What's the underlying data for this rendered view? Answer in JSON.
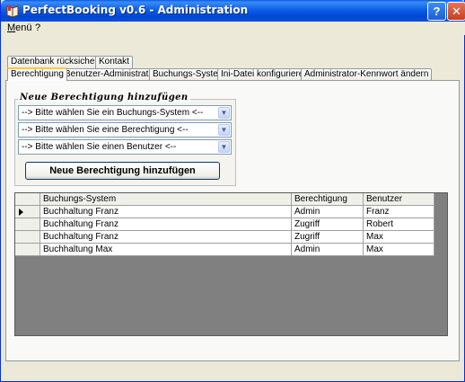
{
  "window": {
    "title": "PerfectBooking v0.6 - Administration",
    "help_label": "?",
    "close_label": "✕"
  },
  "menubar": {
    "items": [
      {
        "label": "Menü",
        "underline": "M"
      },
      {
        "label": "?"
      }
    ]
  },
  "tabs_row1": [
    "Datenbank rücksichern",
    "Kontakt"
  ],
  "tabs_row2": [
    "Berechtigung",
    "Benutzer-Administration",
    "Buchungs-System",
    "Ini-Datei konfigurieren",
    "Administrator-Kennwort ändern"
  ],
  "active_tab": "Berechtigung",
  "group": {
    "title": "Neue Berechtigung hinzufügen",
    "combo_system": "--> Bitte wählen Sie ein Buchungs-System <--",
    "combo_permission": "--> Bitte wählen Sie eine Berechtigung <--",
    "combo_user": "--> Bitte wählen Sie einen Benutzer <--",
    "add_button": "Neue Berechtigung hinzufügen"
  },
  "table": {
    "columns": [
      "Buchungs-System",
      "Berechtigung",
      "Benutzer"
    ],
    "rows": [
      [
        "Buchhaltung Franz",
        "Admin",
        "Franz"
      ],
      [
        "Buchhaltung Franz",
        "Zugriff",
        "Robert"
      ],
      [
        "Buchhaltung Franz",
        "Zugriff",
        "Max"
      ],
      [
        "Buchhaltung Max",
        "Admin",
        "Max"
      ]
    ]
  },
  "colors": {
    "titlebar": "#0A5BEC",
    "active_tab_accent": "#FFC83C",
    "grid_background": "#808080"
  }
}
